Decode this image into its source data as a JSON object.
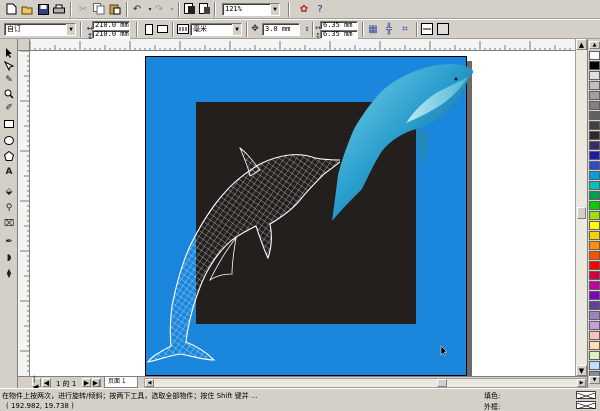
{
  "toolbar": {
    "zoom_value": "121%",
    "paper_preset": "自订",
    "page_width": "210.0 mm",
    "page_height": "210.0 mm",
    "units": "毫米",
    "nudge": "3.0 mm",
    "dup_x": "6.35 mm",
    "dup_y": "6.35 mm"
  },
  "tabs": {
    "page_count": "1 的 1",
    "page_tab": "页面 1"
  },
  "status": {
    "hint": "在物件上按两次，进行旋转/倾斜；按两下工具，选取全部物件；按住 Shift 键并 ...",
    "coords": "( 192.982, 19.738 )",
    "fill_label": "填色:",
    "outline_label": "外框:"
  },
  "colors": {
    "page_bg": "#1a86dc",
    "dark_rect": "#231f1c",
    "dolphin": "#2b9fcf"
  },
  "icons": [
    "new-icon",
    "open-icon",
    "save-icon",
    "print-icon",
    "cut-icon",
    "copy-icon",
    "paste-icon",
    "undo-icon",
    "redo-icon",
    "import-icon",
    "export-icon",
    "zoom-dropdown",
    "corel-icon",
    "help-icon"
  ],
  "palette": [
    "#ffffff",
    "#000000",
    "#e0e0e0",
    "#c0c0c0",
    "#a0a0a0",
    "#808080",
    "#606060",
    "#404040",
    "#2a2a2a",
    "#3a2a6a",
    "#1b1bb0",
    "#2a4ad0",
    "#00a0e0",
    "#00c0c0",
    "#00a050",
    "#00d000",
    "#a0e000",
    "#ffff00",
    "#ffd000",
    "#ff9000",
    "#ff5000",
    "#ff0000",
    "#d00040",
    "#c000a0",
    "#8000c0",
    "#6040a0",
    "#a080c0",
    "#c0a0e0",
    "#ffc0c0",
    "#ffe0b0",
    "#e0f0c0",
    "#c0e0ff",
    "#8090a0"
  ]
}
